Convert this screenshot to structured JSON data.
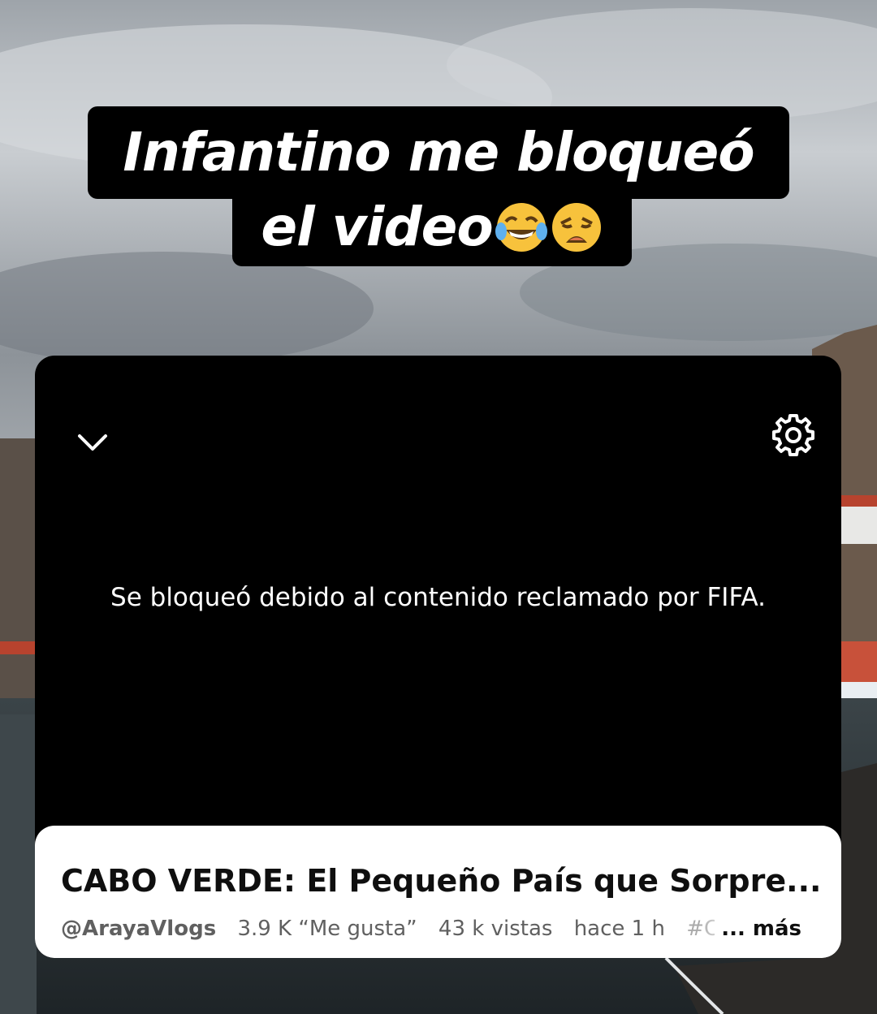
{
  "caption": {
    "line1": "Infantino me bloqueó",
    "line2": "el video",
    "emojis": [
      "tears-of-joy-emoji",
      "weary-face-emoji"
    ]
  },
  "player": {
    "collapse_icon": "chevron-down-icon",
    "settings_icon": "gear-icon",
    "blocked_message": "Se bloqueó debido al contenido reclamado por FIFA."
  },
  "video": {
    "title": "CABO VERDE: El Pequeño País que Sorpre...",
    "channel": "@ArayaVlogs",
    "likes": "3.9 K “Me gusta”",
    "views": "43 k vistas",
    "time": "hace 1 h",
    "hashtag": "#Cabo",
    "more_label": "... más"
  },
  "colors": {
    "card_bg": "#000000",
    "info_bg": "#ffffff",
    "title_color": "#0f0f0f",
    "meta_color": "#606060"
  }
}
